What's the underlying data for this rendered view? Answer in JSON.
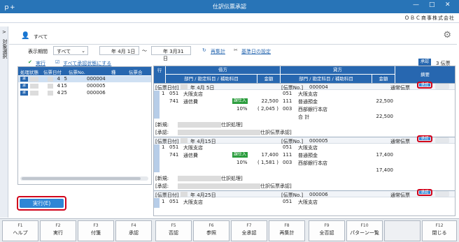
{
  "window": {
    "title": "仕訳伝票承認",
    "app_icon": "ｐ+",
    "company": "ＯＢＣ商事株式会社",
    "minimize": "—",
    "maximize": "□",
    "close": "✕"
  },
  "sidebar": {
    "toggle": ">",
    "label": "対象選択"
  },
  "header": {
    "label": "すべて",
    "gear": "⚙",
    "person": "👤"
  },
  "filter": {
    "period_label": "表示期間",
    "period_value": "すべて",
    "date_from": "年 4月 1日",
    "sep": "～",
    "date_to": "年 3月31日",
    "recalc": "再集計",
    "basedate": "基準日の設定"
  },
  "toolbar": {
    "exec_link": "実行",
    "all_status_link": "すべて承認状態にする",
    "count_label": "承認",
    "count_value": "3 伝票"
  },
  "left_table": {
    "headers": [
      "処理状態",
      "伝票日付",
      "伝票No.",
      "種",
      "伝票合"
    ],
    "rows": [
      {
        "badge": "承",
        "month": "4",
        "day": "5",
        "no": "000004"
      },
      {
        "badge": "承",
        "month": "4",
        "day": "15",
        "no": "000005"
      },
      {
        "badge": "承",
        "month": "4",
        "day": "25",
        "no": "000006"
      }
    ]
  },
  "execute_button": "実行(E)",
  "right_table": {
    "headers": {
      "row": "行",
      "debit": "借方",
      "credit": "貸方",
      "dept": "部門 / 勘定科目 / 補助科目",
      "amount": "金額",
      "summary": "摘要"
    },
    "vouchers": [
      {
        "date_label": "[伝票日付]",
        "date": "年 4月 5日",
        "no_label": "[伝票No.]",
        "no": "000004",
        "type": "通常伝票",
        "approve": "承認",
        "line": "1",
        "d_dept_code": "051",
        "d_dept": "大阪支店",
        "d_acct_code": "741",
        "d_acct": "通信費",
        "tax_tag": "課仕入",
        "d_amount": "22,500",
        "tax_rate": "10%",
        "tax_amt": "( 2,045 )",
        "c_dept_code": "051",
        "c_dept": "大阪支店",
        "c_acct_code": "111",
        "c_acct": "普通預金",
        "c_sub_code": "003",
        "c_sub": "西部銀行本店",
        "c_amount": "22,500",
        "total_label": "合 計",
        "total": "22,500",
        "new_label": "[新規:",
        "new_text": "仕訳処理]",
        "approve_label": "[承認:",
        "approve_text": "仕訳伝票承認]"
      },
      {
        "date_label": "[伝票日付]",
        "date": "年 4月15日",
        "no_label": "[伝票No.]",
        "no": "000005",
        "type": "通常伝票",
        "approve": "承認",
        "line": "1",
        "d_dept_code": "051",
        "d_dept": "大阪支店",
        "d_acct_code": "741",
        "d_acct": "通信費",
        "tax_tag": "課仕入",
        "d_amount": "17,400",
        "tax_rate": "10%",
        "tax_amt": "( 1,581 )",
        "c_dept_code": "051",
        "c_dept": "大阪支店",
        "c_acct_code": "111",
        "c_acct": "普通預金",
        "c_sub_code": "003",
        "c_sub": "西部銀行本店",
        "c_amount": "17,400",
        "total_label": "",
        "total": "17,400",
        "new_label": "[新規:",
        "new_text": "仕訳処理]",
        "approve_label": "[承認:",
        "approve_text": "仕訳伝票承認]"
      },
      {
        "date_label": "[伝票日付]",
        "date": "年 4月25日",
        "no_label": "[伝票No.]",
        "no": "000006",
        "type": "通常伝票",
        "approve": "承認",
        "line": "1",
        "d_dept_code": "051",
        "d_dept": "大阪支店",
        "c_dept_code": "051",
        "c_dept": "大阪支店"
      }
    ]
  },
  "fkeys": [
    {
      "n": "F1",
      "l": "ヘルプ"
    },
    {
      "n": "F2",
      "l": "実行"
    },
    {
      "n": "F3",
      "l": "付箋"
    },
    {
      "n": "F4",
      "l": "承認"
    },
    {
      "n": "F5",
      "l": "否認"
    },
    {
      "n": "F6",
      "l": "参照"
    },
    {
      "n": "F7",
      "l": "全承認"
    },
    {
      "n": "F8",
      "l": "再集計"
    },
    {
      "n": "F9",
      "l": "全否認"
    },
    {
      "n": "F10",
      "l": "パターン一覧"
    },
    {
      "n": "",
      "l": ""
    },
    {
      "n": "F12",
      "l": "閉じる"
    }
  ]
}
